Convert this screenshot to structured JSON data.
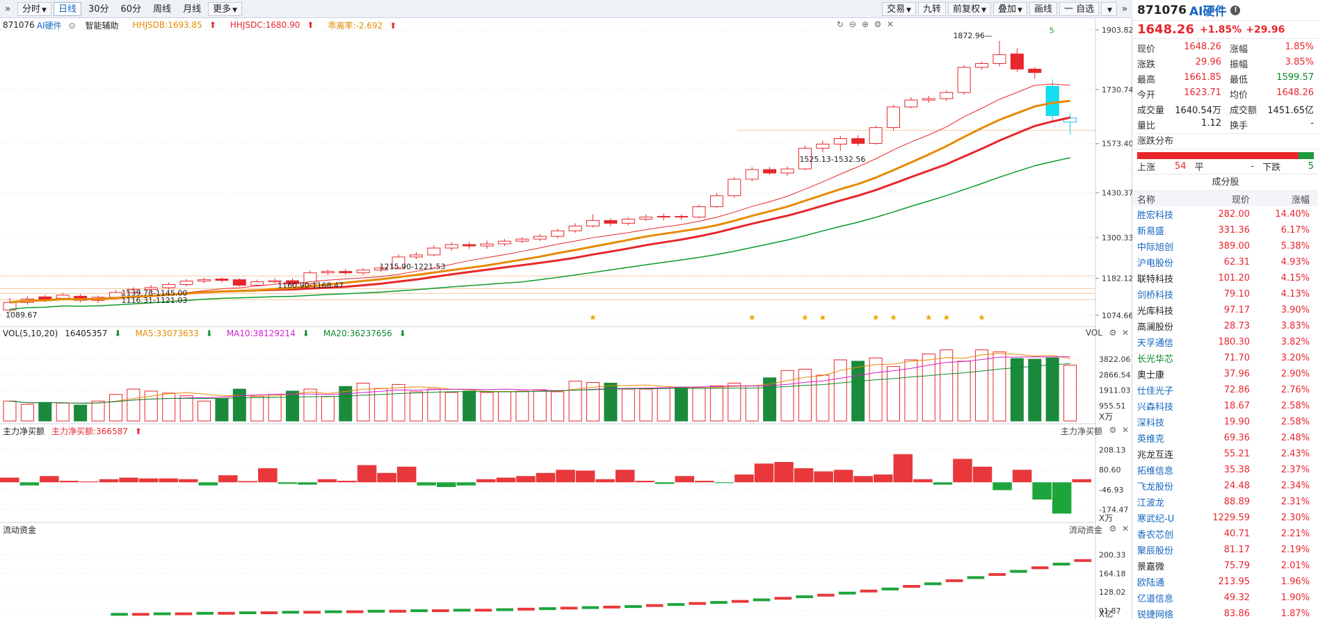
{
  "toolbar": {
    "left": [
      "分时",
      "日线",
      "30分",
      "60分",
      "周线",
      "月线",
      "更多"
    ],
    "active": "日线",
    "right": [
      "交易",
      "九转",
      "前复权",
      "叠加",
      "画线",
      "一 自选"
    ]
  },
  "legend": {
    "code": "871076",
    "name": "AI硬件",
    "assist": "智能辅助",
    "hhjsdb": "HHJSDB:1693.85",
    "hhjsdc": "HHJSDC:1680.90",
    "deviation": "乖离率:-2.692"
  },
  "annotations": {
    "high_label": "1872.96",
    "low_label": "1089.67",
    "box1": "1139.78-1145.00",
    "box2": "1116.31-1121.03",
    "box3": "1160.90-1168.47",
    "box4": "1215.90-1221.53",
    "box5": "1525.13-1532.56",
    "signal": "5"
  },
  "main_axis": [
    "1903.82",
    "1730.74",
    "1573.40",
    "1430.37",
    "1300.33",
    "1182.12",
    "1074.66"
  ],
  "vol": {
    "title": "VOL(5,10,20)",
    "value": "16405357",
    "ma5": "MA5:33073633",
    "ma10": "MA10:38129214",
    "ma20": "MA20:36237656",
    "tag": "VOL",
    "axis": [
      "3822.06",
      "2866.54",
      "1911.03",
      "955.51"
    ],
    "unit": "X万"
  },
  "flow": {
    "title": "主力净买额",
    "value": "主力净买额:366587",
    "tag": "主力净买额",
    "axis": [
      "208.13",
      "80.60",
      "-46.93",
      "-174.47"
    ],
    "unit": "X万"
  },
  "liquid": {
    "title": "流动资金",
    "tag": "流动资金",
    "axis": [
      "200.33",
      "164.18",
      "128.02",
      "91.87"
    ],
    "unit": "X亿"
  },
  "chart_data": {
    "type": "candlestick",
    "candles": [
      [
        1090,
        1112,
        1125,
        1082
      ],
      [
        1112,
        1122,
        1130,
        1105
      ],
      [
        1128,
        1120,
        1134,
        1114
      ],
      [
        1124,
        1133,
        1140,
        1120
      ],
      [
        1130,
        1118,
        1136,
        1112
      ],
      [
        1118,
        1127,
        1132,
        1110
      ],
      [
        1127,
        1141,
        1148,
        1120
      ],
      [
        1141,
        1150,
        1156,
        1136
      ],
      [
        1150,
        1155,
        1162,
        1144
      ],
      [
        1155,
        1164,
        1170,
        1150
      ],
      [
        1164,
        1174,
        1180,
        1158
      ],
      [
        1174,
        1178,
        1184,
        1168
      ],
      [
        1180,
        1176,
        1185,
        1170
      ],
      [
        1178,
        1162,
        1182,
        1158
      ],
      [
        1162,
        1172,
        1178,
        1158
      ],
      [
        1172,
        1175,
        1182,
        1168
      ],
      [
        1175,
        1166,
        1182,
        1160
      ],
      [
        1166,
        1198,
        1205,
        1162
      ],
      [
        1198,
        1202,
        1208,
        1192
      ],
      [
        1202,
        1198,
        1210,
        1192
      ],
      [
        1198,
        1206,
        1212,
        1192
      ],
      [
        1206,
        1212,
        1218,
        1200
      ],
      [
        1212,
        1244,
        1252,
        1208
      ],
      [
        1244,
        1250,
        1258,
        1238
      ],
      [
        1250,
        1270,
        1278,
        1246
      ],
      [
        1270,
        1280,
        1287,
        1262
      ],
      [
        1280,
        1276,
        1288,
        1268
      ],
      [
        1276,
        1282,
        1292,
        1268
      ],
      [
        1282,
        1290,
        1296,
        1276
      ],
      [
        1290,
        1296,
        1302,
        1284
      ],
      [
        1296,
        1304,
        1310,
        1290
      ],
      [
        1304,
        1320,
        1326,
        1298
      ],
      [
        1320,
        1334,
        1342,
        1314
      ],
      [
        1334,
        1350,
        1368,
        1330
      ],
      [
        1350,
        1342,
        1356,
        1334
      ],
      [
        1342,
        1354,
        1360,
        1336
      ],
      [
        1354,
        1360,
        1368,
        1348
      ],
      [
        1360,
        1362,
        1370,
        1350
      ],
      [
        1362,
        1360,
        1368,
        1352
      ],
      [
        1360,
        1390,
        1396,
        1356
      ],
      [
        1390,
        1422,
        1430,
        1386
      ],
      [
        1422,
        1470,
        1476,
        1416
      ],
      [
        1470,
        1498,
        1505,
        1464
      ],
      [
        1498,
        1488,
        1506,
        1482
      ],
      [
        1488,
        1500,
        1508,
        1480
      ],
      [
        1500,
        1560,
        1568,
        1496
      ],
      [
        1560,
        1572,
        1582,
        1548
      ],
      [
        1572,
        1588,
        1596,
        1552
      ],
      [
        1588,
        1574,
        1598,
        1566
      ],
      [
        1574,
        1620,
        1626,
        1570
      ],
      [
        1620,
        1680,
        1686,
        1612
      ],
      [
        1680,
        1700,
        1708,
        1676
      ],
      [
        1700,
        1704,
        1712,
        1692
      ],
      [
        1704,
        1722,
        1728,
        1698
      ],
      [
        1722,
        1795,
        1802,
        1716
      ],
      [
        1795,
        1806,
        1812,
        1788
      ],
      [
        1806,
        1832,
        1872,
        1798
      ],
      [
        1834,
        1790,
        1850,
        1782
      ],
      [
        1790,
        1780,
        1796,
        1762
      ],
      [
        1740,
        1655,
        1760,
        1640
      ],
      [
        1636,
        1648,
        1662,
        1600
      ]
    ],
    "vol": [
      30,
      25,
      28,
      27,
      24,
      30,
      40,
      48,
      45,
      42,
      38,
      30,
      34,
      48,
      37,
      40,
      45,
      48,
      37,
      52,
      57,
      49,
      55,
      44,
      48,
      43,
      45,
      43,
      44,
      45,
      47,
      44,
      60,
      58,
      57,
      48,
      48,
      50,
      51,
      50,
      53,
      57,
      53,
      65,
      76,
      78,
      69,
      92,
      90,
      95,
      82,
      92,
      101,
      107,
      90,
      107,
      104,
      94,
      93,
      95,
      84,
      39
    ],
    "flow": [
      30,
      -20,
      40,
      10,
      5,
      20,
      30,
      25,
      25,
      20,
      -20,
      45,
      8,
      90,
      -10,
      -15,
      20,
      10,
      110,
      60,
      100,
      -20,
      -30,
      -20,
      20,
      30,
      40,
      60,
      80,
      75,
      20,
      80,
      10,
      -10,
      40,
      10,
      -5,
      50,
      120,
      130,
      90,
      70,
      80,
      40,
      50,
      180,
      20,
      -15,
      150,
      100,
      -50,
      80,
      -110,
      -200,
      20
    ],
    "liquid": [
      85,
      85,
      86,
      86,
      87,
      87,
      88,
      88,
      89,
      89,
      90,
      90,
      91,
      91,
      92,
      92,
      93,
      93,
      94,
      95,
      96,
      97,
      98,
      99,
      100,
      102,
      104,
      106,
      108,
      110,
      113,
      116,
      119,
      122,
      126,
      130,
      134,
      139,
      144,
      150,
      156,
      162,
      168,
      175,
      182,
      189,
      196,
      203,
      210,
      216,
      222
    ]
  },
  "stock": {
    "code": "871076",
    "name": "AI硬件",
    "price": "1648.26",
    "pct": "+1.85%",
    "change": "+29.96",
    "rows": [
      [
        "现价",
        "1648.26",
        "涨幅",
        "1.85%"
      ],
      [
        "涨跌",
        "29.96",
        "振幅",
        "3.85%"
      ],
      [
        "最高",
        "1661.85",
        "最低",
        "1599.57"
      ],
      [
        "今开",
        "1623.71",
        "均价",
        "1648.26"
      ],
      [
        "成交量",
        "1640.54万",
        "成交额",
        "1451.65亿"
      ],
      [
        "量比",
        "1.12",
        "换手",
        "-"
      ]
    ],
    "dist_title": "涨跌分布",
    "up_label": "上涨",
    "up_count": "54",
    "flat_label": "平",
    "flat_count": "-",
    "down_label": "下跌",
    "down_count": "5",
    "constituents_title": "成分股",
    "headers": [
      "名称",
      "现价",
      "涨幅"
    ],
    "constituents": [
      [
        "胜宏科技",
        "282.00",
        "14.40%",
        "b"
      ],
      [
        "新易盛",
        "331.36",
        "6.17%",
        "b"
      ],
      [
        "中际旭创",
        "389.00",
        "5.38%",
        "b"
      ],
      [
        "沪电股份",
        "62.31",
        "4.93%",
        "b"
      ],
      [
        "联特科技",
        "101.20",
        "4.15%",
        "d"
      ],
      [
        "剑桥科技",
        "79.10",
        "4.13%",
        "b"
      ],
      [
        "光库科技",
        "97.17",
        "3.90%",
        "d"
      ],
      [
        "高澜股份",
        "28.73",
        "3.83%",
        "d"
      ],
      [
        "天孚通信",
        "180.30",
        "3.82%",
        "b"
      ],
      [
        "长光华芯",
        "71.70",
        "3.20%",
        "g"
      ],
      [
        "奥士康",
        "37.96",
        "2.90%",
        "d"
      ],
      [
        "仕佳光子",
        "72.86",
        "2.76%",
        "b"
      ],
      [
        "兴森科技",
        "18.67",
        "2.58%",
        "b"
      ],
      [
        "深科技",
        "19.90",
        "2.58%",
        "b"
      ],
      [
        "英维克",
        "69.36",
        "2.48%",
        "b"
      ],
      [
        "兆龙互连",
        "55.21",
        "2.43%",
        "d"
      ],
      [
        "拓维信息",
        "35.38",
        "2.37%",
        "b"
      ],
      [
        "飞龙股份",
        "24.48",
        "2.34%",
        "b"
      ],
      [
        "江波龙",
        "88.89",
        "2.31%",
        "b"
      ],
      [
        "寒武纪-U",
        "1229.59",
        "2.30%",
        "b"
      ],
      [
        "香农芯创",
        "40.71",
        "2.21%",
        "b"
      ],
      [
        "聚辰股份",
        "81.17",
        "2.19%",
        "b"
      ],
      [
        "景嘉微",
        "75.79",
        "2.01%",
        "d"
      ],
      [
        "欧陆通",
        "213.95",
        "1.96%",
        "b"
      ],
      [
        "亿道信息",
        "49.32",
        "1.90%",
        "b"
      ],
      [
        "锐捷网络",
        "83.86",
        "1.87%",
        "b"
      ]
    ]
  }
}
